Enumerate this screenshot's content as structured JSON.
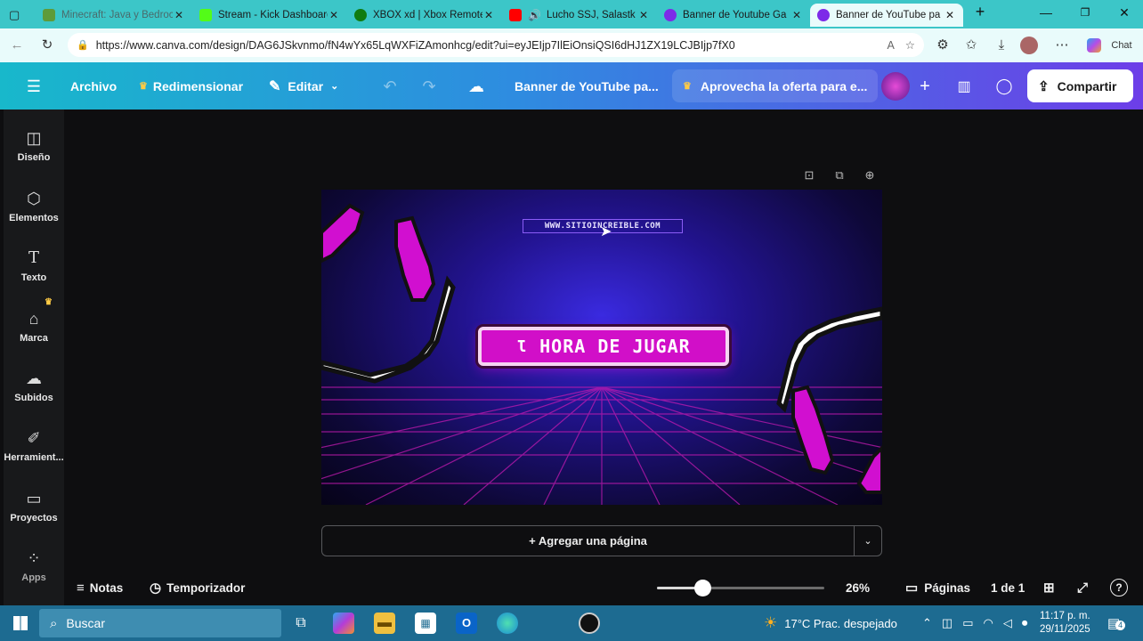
{
  "browser": {
    "tabs": [
      {
        "label": "Minecraft: Java y Bedrock",
        "favicon_color": "#5e9b3a"
      },
      {
        "label": "Stream - Kick Dashboard",
        "favicon_color": "#53fc18"
      },
      {
        "label": "XBOX xd | Xbox Remote",
        "favicon_color": "#107c10"
      },
      {
        "label": "Lucho SSJ, Salastk",
        "favicon_color": "#ff0000"
      },
      {
        "label": "Banner de Youtube Ga",
        "favicon_color": "#7d2ae8"
      },
      {
        "label": "Banner de YouTube pa",
        "favicon_color": "#7d2ae8"
      }
    ],
    "url": "https://www.canva.com/design/DAG6JSkvnmo/fN4wYx65LqWXFiZAmonhcg/edit?ui=eyJEIjp7IlEiOnsiQSI6dHJ1ZX19LCJBIjp7fX0",
    "copilot_label": "Chat"
  },
  "canva": {
    "menu": {
      "archivo": "Archivo",
      "redimensionar": "Redimensionar",
      "editar": "Editar",
      "design_title": "Banner de YouTube pa...",
      "offer": "Aprovecha la oferta para e...",
      "share": "Compartir"
    },
    "sidebar": [
      {
        "label": "Diseño",
        "icon": "layout-icon"
      },
      {
        "label": "Elementos",
        "icon": "shapes-icon"
      },
      {
        "label": "Texto",
        "icon": "text-icon"
      },
      {
        "label": "Marca",
        "icon": "brand-icon"
      },
      {
        "label": "Subidos",
        "icon": "cloud-upload-icon"
      },
      {
        "label": "Herramient...",
        "icon": "tools-icon"
      },
      {
        "label": "Proyectos",
        "icon": "folder-icon"
      },
      {
        "label": "Apps",
        "icon": "apps-icon"
      }
    ],
    "design": {
      "url_text": "WWW.SITIOINCREIBLE.COM",
      "headline": "HORA DE JUGAR"
    },
    "add_page": "+ Agregar una página",
    "bottom": {
      "notes": "Notas",
      "timer": "Temporizador",
      "zoom": "26%",
      "pages_label": "Páginas",
      "page_count": "1 de 1",
      "zoom_fraction": 0.26
    }
  },
  "taskbar": {
    "search_placeholder": "Buscar",
    "weather": "17°C  Prac. despejado",
    "time": "11:17 p. m.",
    "date": "29/11/2025",
    "notif_count": "4"
  }
}
